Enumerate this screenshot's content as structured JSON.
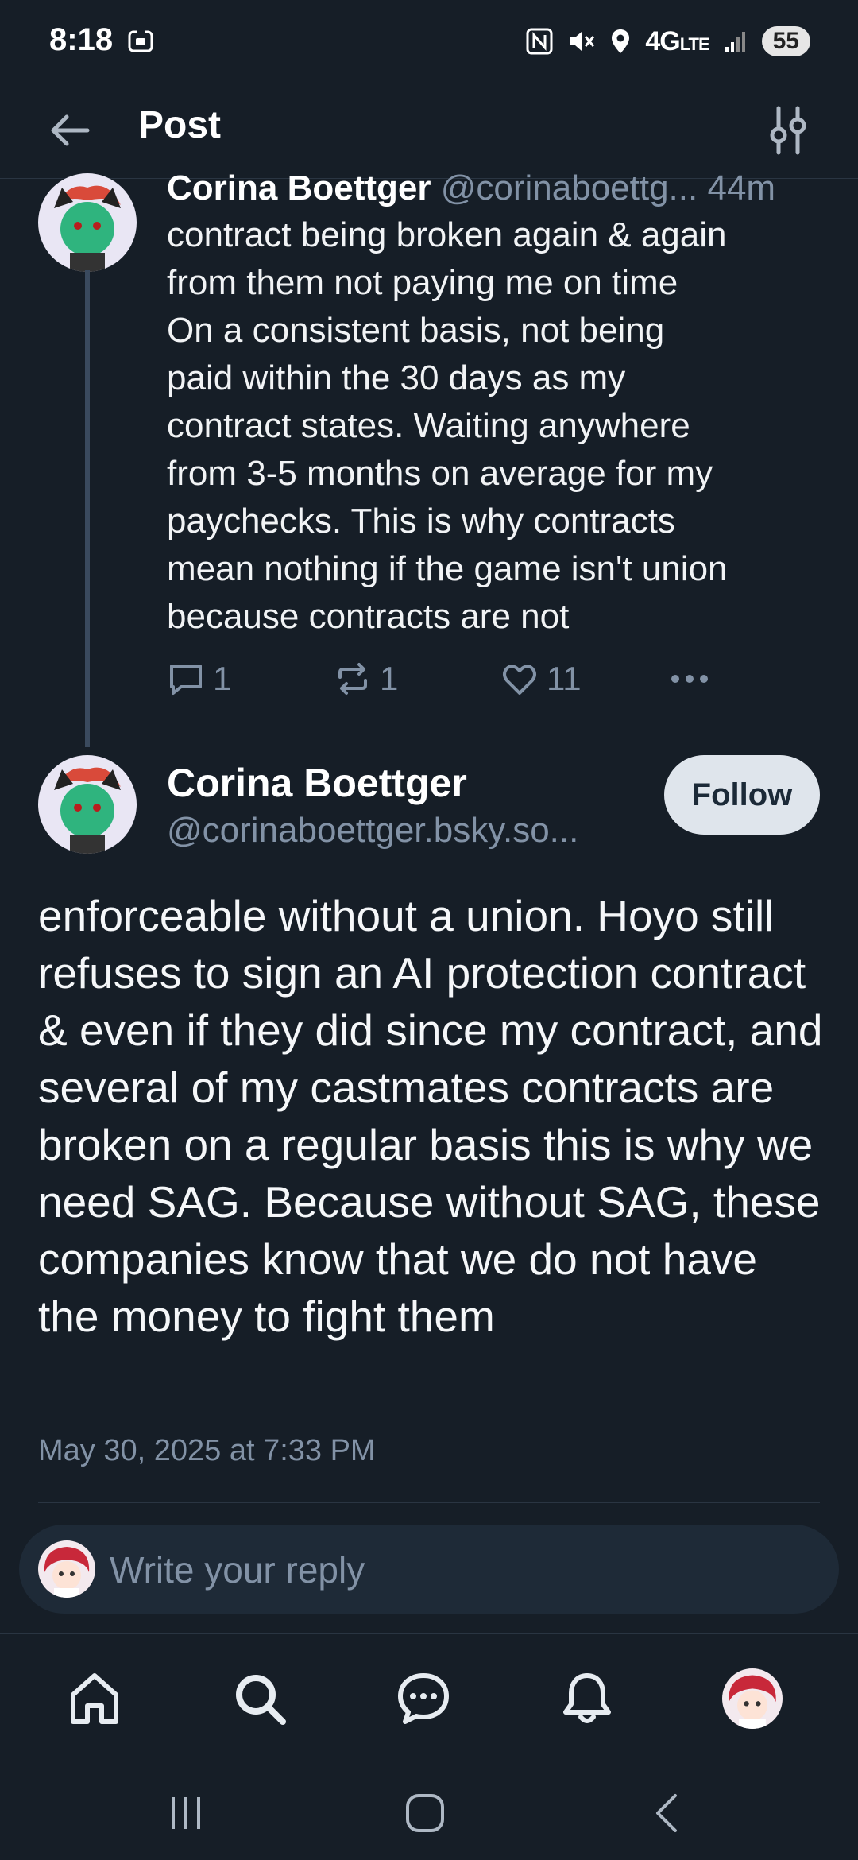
{
  "status_bar": {
    "time": "8:18",
    "network": "4G",
    "network_sub": "LTE",
    "battery": "55"
  },
  "header": {
    "title": "Post"
  },
  "parent_post": {
    "author_name": "Corina Boettger",
    "author_handle": "@corinaboettg...",
    "age": "44m",
    "text": "contract being broken again & again\nfrom them not paying me on time\nOn a consistent basis, not being\npaid within the 30 days as my\ncontract states. Waiting anywhere\nfrom 3-5 months on average for my\npaychecks. This is why contracts\nmean nothing if the game isn't union\nbecause contracts are not",
    "reply_count": "1",
    "repost_count": "1",
    "like_count": "11"
  },
  "main_post": {
    "author_name": "Corina Boettger",
    "author_handle": "@corinaboettger.bsky.so...",
    "follow_label": "Follow",
    "text": "enforceable without a union. Hoyo still refuses to sign an AI protection contract & even if they did since my contract, and several of my castmates contracts are broken on a regular basis this is why we need SAG. Because without SAG, these companies know that we do not have the money to fight them",
    "date": "May 30, 2025 at 7:33 PM"
  },
  "reply_box": {
    "placeholder": "Write your reply"
  },
  "colors": {
    "background": "#161e27",
    "muted_text": "#8292a6",
    "follow_button": "#dfe5ec"
  }
}
